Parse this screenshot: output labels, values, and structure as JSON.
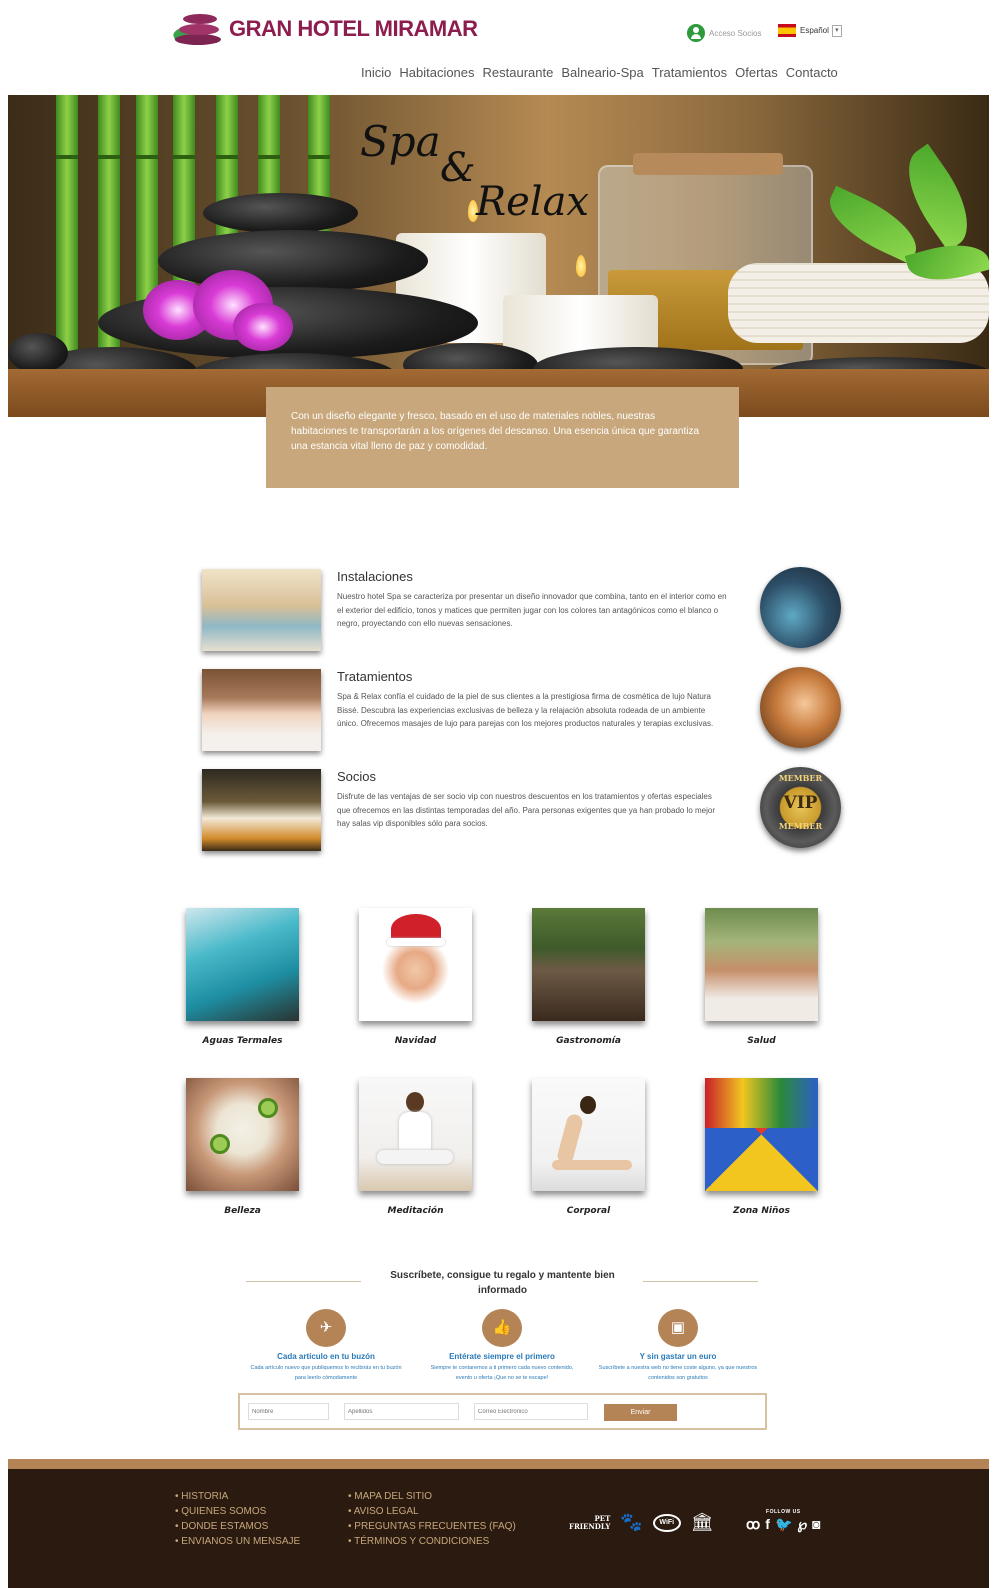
{
  "header": {
    "logo_text": "GRAN HOTEL MIRAMAR",
    "acceso_label": "Acceso Socios",
    "language": "Español",
    "nav": [
      "Inicio",
      "Habitaciones",
      "Restaurante",
      "Balneario-Spa",
      "Tratamientos",
      "Ofertas",
      "Contacto"
    ]
  },
  "hero": {
    "title_word1": "Spa",
    "title_amp": "&",
    "title_word2": "Relax",
    "intro_text": "Con un diseño elegante y fresco, basado en el uso de materiales nobles, nuestras habitaciones te transportarán a los orígenes del descanso. Una esencia única que garantiza una estancia vital lleno de paz y comodidad."
  },
  "features": [
    {
      "title": "Instalaciones",
      "text": "Nuestro hotel Spa se caracteriza por presentar un diseño innovador que combina, tanto en el interior como en el exterior del edificio, tonos y matices que permiten jugar con los colores tan antagónicos como el blanco o negro, proyectando con ello nuevas sensaciones."
    },
    {
      "title": "Tratamientos",
      "text": "Spa & Relax confía el cuidado de la piel de sus clientes a la prestigiosa firma de cosmética de lujo Natura Bissé. Descubra las experiencias exclusivas de belleza y la relajación absoluta rodeada de un ambiente único. Ofrecemos masajes de lujo para parejas con los mejores productos naturales y terapias exclusivas."
    },
    {
      "title": "Socios",
      "text": "Disfrute de las ventajas de ser socio vip con nuestros descuentos en los tratamientos y ofertas especiales que ofrecemos en las distintas temporadas del año. Para personas exigentes que ya han probado lo mejor hay salas vip disponibles sólo para socios."
    }
  ],
  "vip_badge": {
    "top": "MEMBER",
    "center": "VIP",
    "bottom": "MEMBER"
  },
  "gallery": [
    "Aguas Termales",
    "Navidad",
    "Gastronomía",
    "Salud",
    "Belleza",
    "Meditación",
    "Corporal",
    "Zona Niños"
  ],
  "newsletter": {
    "title": "Suscríbete, consigue tu regalo y mantente bien informado",
    "perks": [
      {
        "icon": "airplane-icon",
        "title": "Cada artículo en tu buzón",
        "text": "Cada artículo nuevo que publiquemos lo recibirás en tu buzón para leerlo cómodamente"
      },
      {
        "icon": "thumbs-up-icon",
        "title": "Entérate siempre el primero",
        "text": "Siempre te contaremos a ti primero cada nuevo contenido, evento u oferta ¡Que no se te escape!"
      },
      {
        "icon": "money-icon",
        "title": "Y sin gastar un euro",
        "text": "Suscríbete a nuestra web no tiene coste alguno, ya que nuestros contenidos son gratuitos"
      }
    ],
    "placeholders": {
      "nombre": "Nombre",
      "apellidos": "Apellidos",
      "email": "Correo Electrónico"
    },
    "send_label": "Enviar"
  },
  "footer": {
    "col1": [
      "HISTORIA",
      "QUIENES SOMOS",
      "DONDE ESTAMOS",
      "ENVIANOS UN MENSAJE"
    ],
    "col2": [
      "MAPA DEL SITIO",
      "AVISO LEGAL",
      "PREGUNTAS FRECUENTES (FAQ)",
      "TÉRMINOS Y CONDICIONES"
    ],
    "pet_line1": "PET",
    "pet_line2": "FRIENDLY",
    "wifi_label": "WiFi",
    "follow_us": "FOLLOW US",
    "accent": "#c7a77b",
    "background": "#2a1a10"
  }
}
